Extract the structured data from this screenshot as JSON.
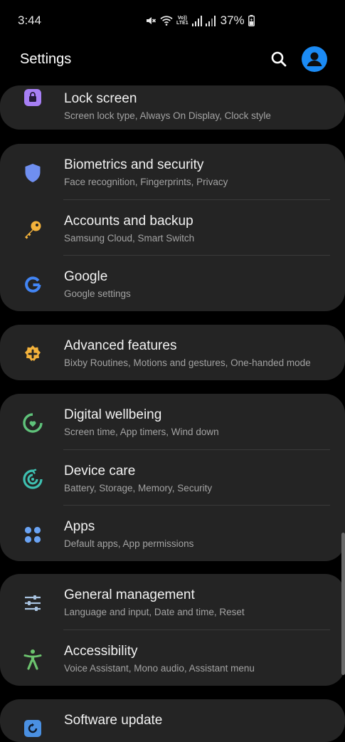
{
  "status_bar": {
    "time": "3:44",
    "lte_top": "Vo))",
    "lte_bottom": "LTE1",
    "battery": "37%",
    "icons": [
      "mute-icon",
      "wifi-icon",
      "lte-icon",
      "signal-icon",
      "signal-icon",
      "battery-icon"
    ]
  },
  "app_bar": {
    "title": "Settings",
    "icons": [
      "search-icon",
      "profile-icon"
    ],
    "profile_color": "#1b8bf5"
  },
  "items": [
    {
      "title": "Lock screen",
      "subtitle": "Screen lock type, Always On Display, Clock style",
      "icon": "lock-icon",
      "color": "#a77ff5"
    },
    {
      "title": "Biometrics and security",
      "subtitle": "Face recognition, Fingerprints, Privacy",
      "icon": "shield-icon",
      "color": "#6f8ff0"
    },
    {
      "title": "Accounts and backup",
      "subtitle": "Samsung Cloud, Smart Switch",
      "icon": "key-icon",
      "color": "#f3b23b"
    },
    {
      "title": "Google",
      "subtitle": "Google settings",
      "icon": "google-icon",
      "color": "#4285f4"
    },
    {
      "title": "Advanced features",
      "subtitle": "Bixby Routines, Motions and gestures, One-handed mode",
      "icon": "advanced-features-icon",
      "color": "#f3b23b"
    },
    {
      "title": "Digital wellbeing",
      "subtitle": "Screen time, App timers, Wind down",
      "icon": "wellbeing-icon",
      "color": "#5fc27a"
    },
    {
      "title": "Device care",
      "subtitle": "Battery, Storage, Memory, Security",
      "icon": "device-care-icon",
      "color": "#3ec0b1"
    },
    {
      "title": "Apps",
      "subtitle": "Default apps, App permissions",
      "icon": "apps-icon",
      "color": "#6aa3f3"
    },
    {
      "title": "General management",
      "subtitle": "Language and input, Date and time, Reset",
      "icon": "sliders-icon",
      "color": "#a9c3e0"
    },
    {
      "title": "Accessibility",
      "subtitle": "Voice Assistant, Mono audio, Assistant menu",
      "icon": "accessibility-icon",
      "color": "#6cc36e"
    },
    {
      "title": "Software update",
      "subtitle": "",
      "icon": "software-update-icon",
      "color": "#4a90e2"
    }
  ]
}
